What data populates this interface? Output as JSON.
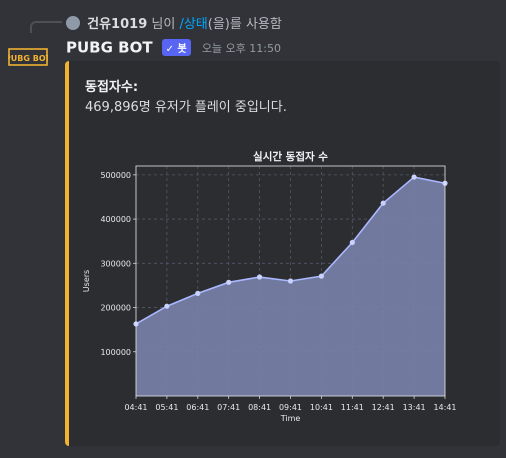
{
  "reply": {
    "user": "건유1019",
    "text_mid": " 님이 ",
    "command": "/상태",
    "text_end": "(을)를 사용함"
  },
  "message": {
    "bot_name": "PUBG BOT",
    "badge": "✓ 봇",
    "timestamp": "오늘 오후 11:50",
    "avatar_text": "PUBG BOT"
  },
  "embed": {
    "accent_color": "#f0b232",
    "field_name": "동접자수:",
    "field_value": "469,896명 유저가 플레이 중입니다."
  },
  "chart_data": {
    "type": "area",
    "title": "실시간 동접자 수",
    "xlabel": "Time",
    "ylabel": "Users",
    "categories": [
      "04:41",
      "05:41",
      "06:41",
      "07:41",
      "08:41",
      "09:41",
      "10:41",
      "11:41",
      "12:41",
      "13:41",
      "14:41"
    ],
    "values": [
      163000,
      203000,
      232000,
      257000,
      269000,
      260000,
      271000,
      347000,
      436000,
      495000,
      481000
    ],
    "ylim": [
      0,
      520000
    ],
    "yticks": [
      100000,
      200000,
      300000,
      400000,
      500000
    ],
    "grid": true,
    "fill_color": "#7a82ac",
    "line_color": "#aab8ff",
    "marker_color": "#c8d2ff"
  }
}
